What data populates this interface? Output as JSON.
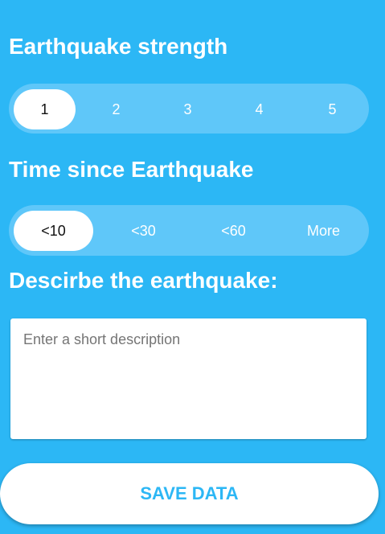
{
  "strength": {
    "title": "Earthquake strength",
    "options": [
      "1",
      "2",
      "3",
      "4",
      "5"
    ],
    "selected": "1"
  },
  "time": {
    "title": "Time since Earthquake",
    "options": [
      "<10",
      "<30",
      "<60",
      "More"
    ],
    "selected": "<10"
  },
  "description": {
    "title": "Descirbe the earthquake:",
    "value": "",
    "placeholder": "Enter a short description"
  },
  "save_label": "SAVE DATA",
  "colors": {
    "background": "#2cb7f5",
    "segment": "#5fc7f9",
    "accent": "#2cb7f5"
  }
}
